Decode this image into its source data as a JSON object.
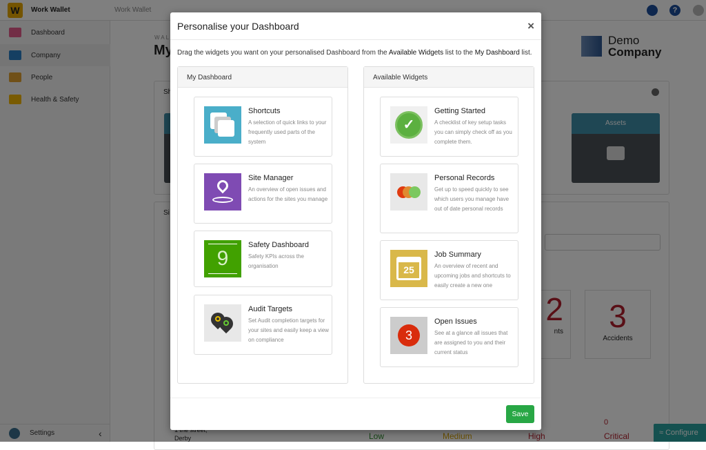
{
  "app": {
    "name": "Work Wallet",
    "breadcrumb": "Work Wallet",
    "logo_letter": "W"
  },
  "sidebar": {
    "items": [
      {
        "label": "Dashboard",
        "color": "#e45c8c"
      },
      {
        "label": "Company",
        "color": "#2a7fc4"
      },
      {
        "label": "People",
        "color": "#e0a030"
      },
      {
        "label": "Health & Safety",
        "color": "#f2b705"
      }
    ],
    "settings": "Settings",
    "collapse": "‹"
  },
  "background": {
    "eyebrow": "WALL",
    "title": "My",
    "panel1": "Sh",
    "panel2": "Si",
    "tile_assets": "Assets",
    "incidents_label": "nts",
    "incidents_value": "2",
    "accidents_value": "3",
    "accidents_label": "Accidents",
    "critical_value": "0",
    "levels": [
      "Low",
      "Medium",
      "High",
      "Critical"
    ],
    "address": [
      "1 the street,",
      "Derby"
    ],
    "configure": "Configure",
    "company": {
      "line1": "Demo",
      "line2": "Company"
    }
  },
  "modal": {
    "title": "Personalise your Dashboard",
    "close": "×",
    "desc_pre": "Drag the widgets you want on your personalised Dashboard from the ",
    "desc_b1": "Available Widgets",
    "desc_mid": " list to the ",
    "desc_b2": "My Dashboard",
    "desc_post": " list.",
    "my_dashboard": {
      "title": "My Dashboard",
      "widgets": [
        {
          "title": "Shortcuts",
          "desc": "A selection of quick links to your frequently used parts of the system",
          "icon": "shortcuts-icon",
          "color": "#4aaec9"
        },
        {
          "title": "Site Manager",
          "desc": "An overview of open issues and actions for the sites you manage",
          "icon": "map-pin-icon",
          "color": "#7f4bb3"
        },
        {
          "title": "Safety Dashboard",
          "desc": "Safety KPIs across the organisation",
          "icon": "safety-kpi-icon",
          "color": "#41a100",
          "glyph": "9"
        },
        {
          "title": "Audit Targets",
          "desc": "Set Audit completion targets for your sites and easily keep a view on compliance",
          "icon": "audit-pins-icon",
          "color": "#e8e8e8"
        }
      ]
    },
    "available": {
      "title": "Available Widgets",
      "widgets": [
        {
          "title": "Getting Started",
          "desc": "A checklist of key setup tasks you can simply check off as you complete them.",
          "icon": "check-circle-icon",
          "color": "#f0f0f0"
        },
        {
          "title": "Personal Records",
          "desc": "Get up to speed quickly to see which users you manage have out of date personal records",
          "icon": "records-dots-icon",
          "color": "#e8e8e8"
        },
        {
          "title": "Job Summary",
          "desc": "An overview of recent and upcoming jobs and shortcuts to easily create a new one",
          "icon": "calendar-icon",
          "color": "#d9b84a",
          "glyph": "25"
        },
        {
          "title": "Open Issues",
          "desc": "See at a glance all issues that are assigned to you and their current status",
          "icon": "issues-count-icon",
          "color": "#cccccc",
          "glyph": "3"
        }
      ]
    },
    "save": "Save"
  }
}
